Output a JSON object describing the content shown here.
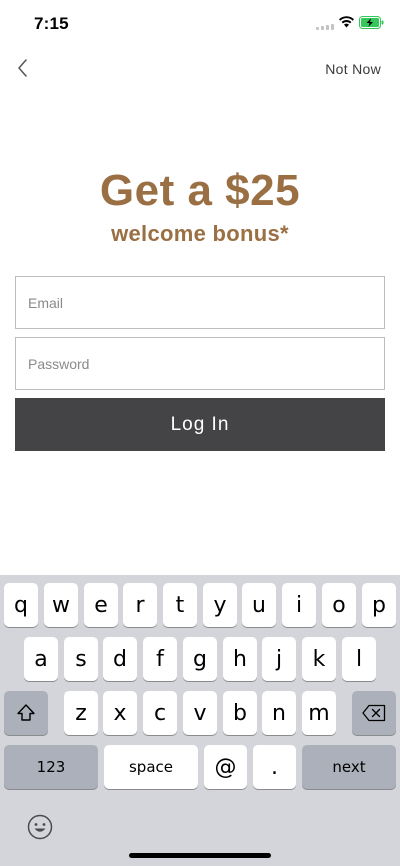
{
  "status_bar": {
    "time": "7:15"
  },
  "nav": {
    "back_icon": "chevron-left-icon",
    "not_now_label": "Not Now"
  },
  "promo": {
    "headline": "Get a $25",
    "subhead": "welcome bonus*"
  },
  "form": {
    "email_placeholder": "Email",
    "password_placeholder": "Password",
    "login_label": "Log In"
  },
  "colors": {
    "accent": "#9a6f43",
    "button": "#444446",
    "keyboard_bg": "#d3d5da"
  },
  "keyboard": {
    "row1": [
      "q",
      "w",
      "e",
      "r",
      "t",
      "y",
      "u",
      "i",
      "o",
      "p"
    ],
    "row2": [
      "a",
      "s",
      "d",
      "f",
      "g",
      "h",
      "j",
      "k",
      "l"
    ],
    "row3": [
      "z",
      "x",
      "c",
      "v",
      "b",
      "n",
      "m"
    ],
    "numbers_label": "123",
    "space_label": "space",
    "at_label": "@",
    "period_label": ".",
    "next_label": "next"
  }
}
